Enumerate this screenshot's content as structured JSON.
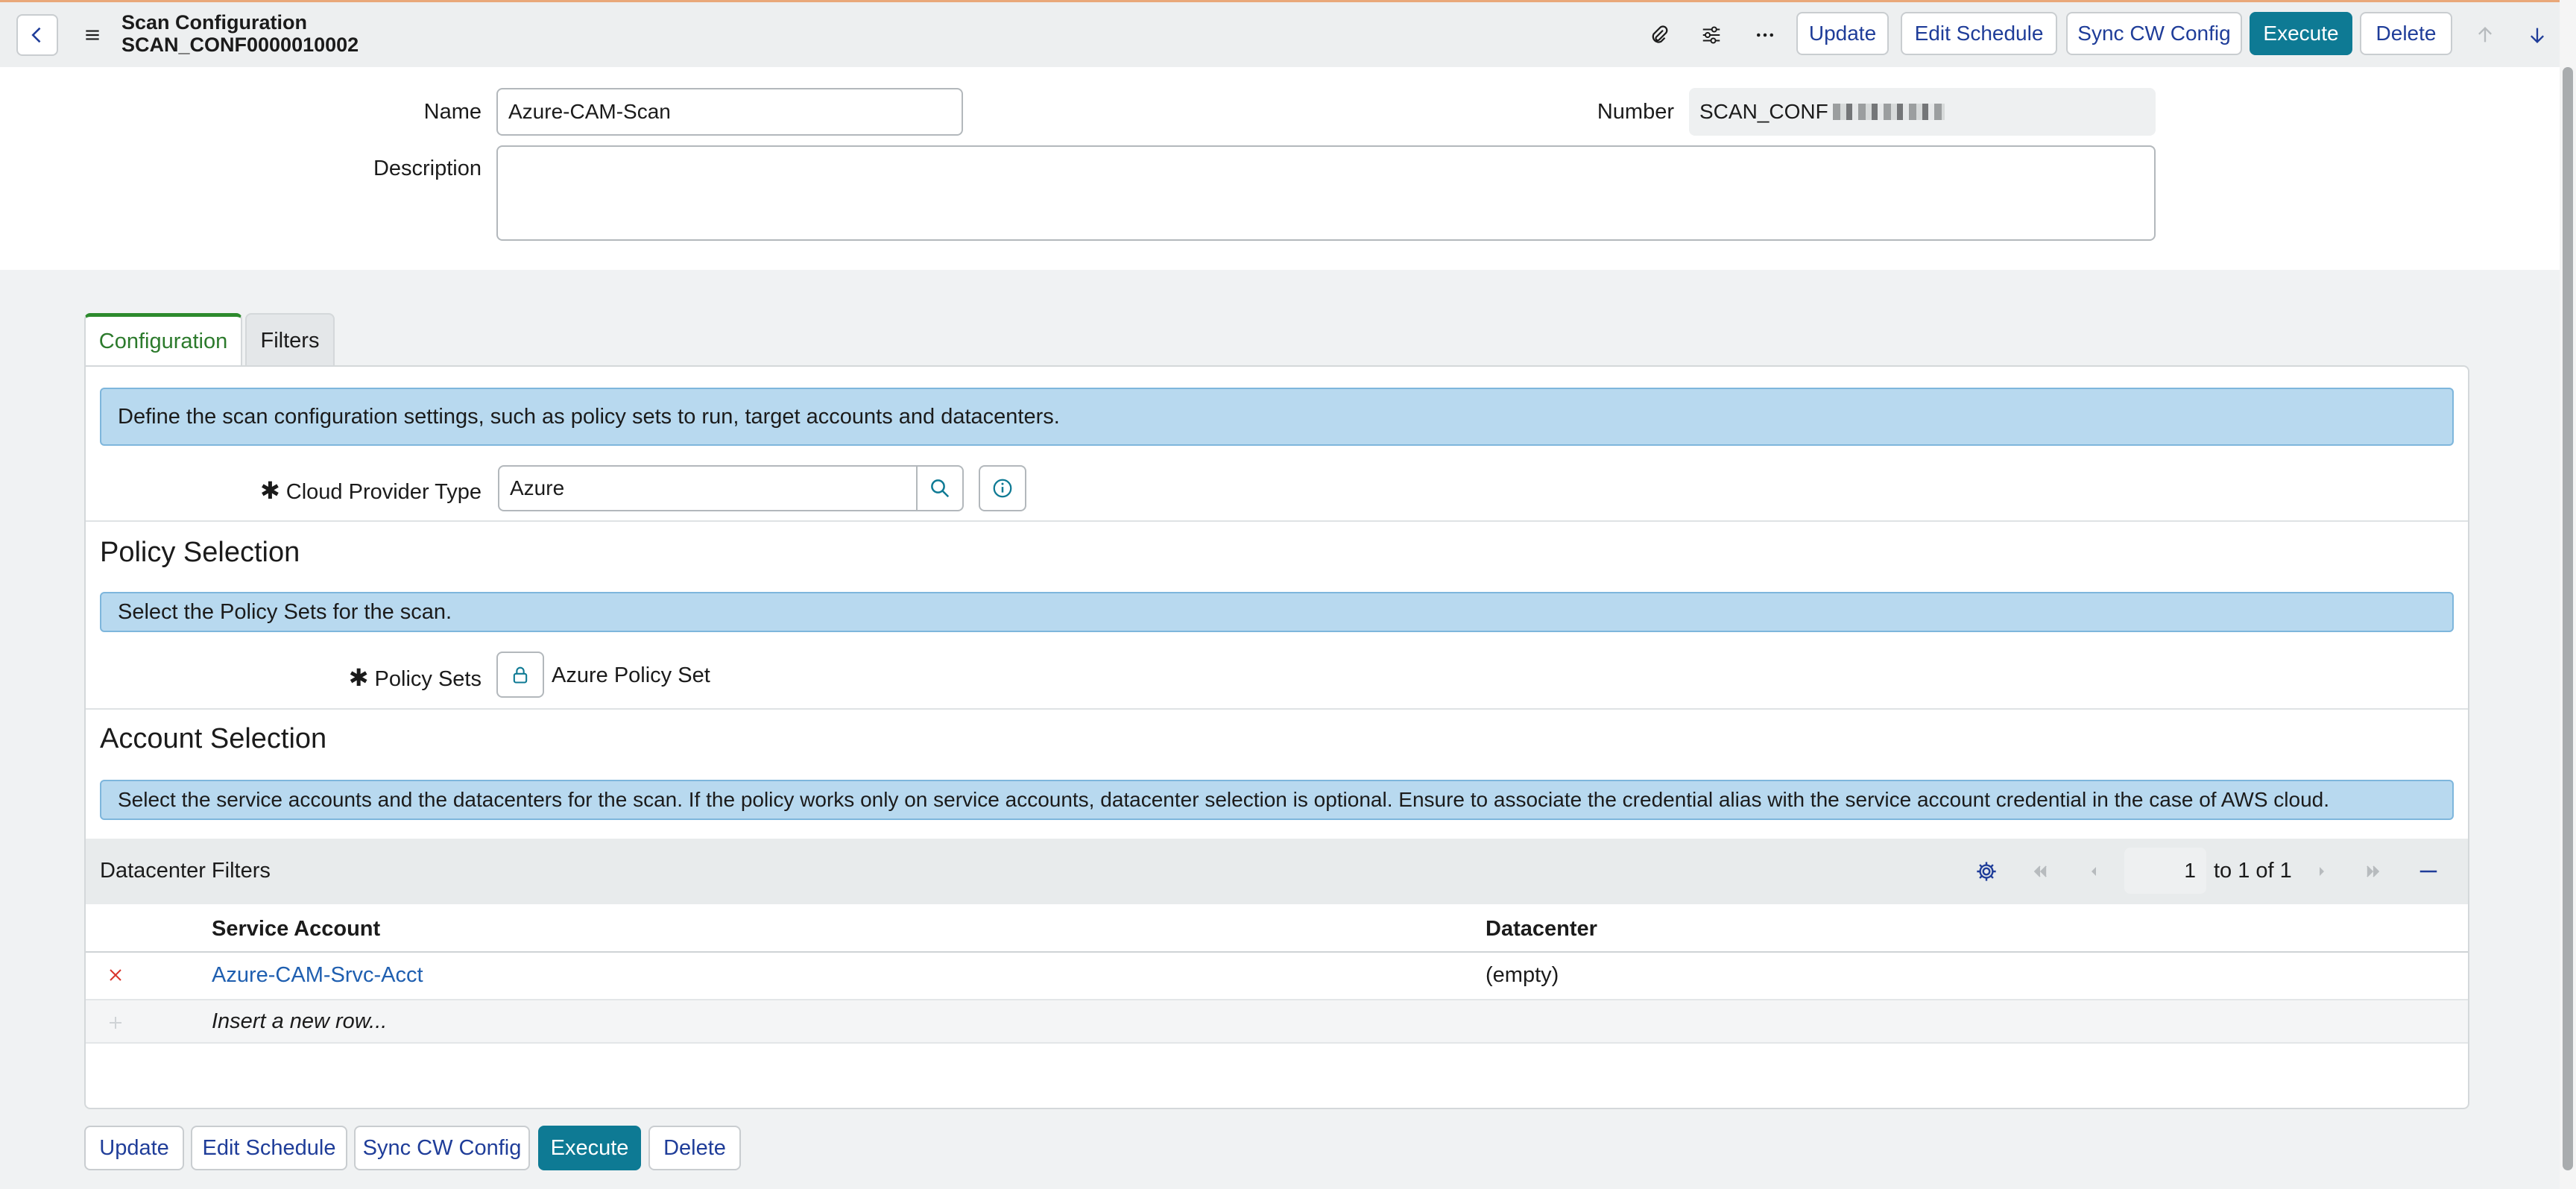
{
  "header": {
    "form_type": "Scan Configuration",
    "record_number": "SCAN_CONF0000010002",
    "buttons": {
      "update": "Update",
      "edit_schedule": "Edit Schedule",
      "sync_cw_config": "Sync CW Config",
      "execute": "Execute",
      "delete": "Delete"
    },
    "icons": [
      "back-icon",
      "menu-icon",
      "paperclip-icon",
      "settings-sliders-icon",
      "more-icon",
      "arrow-up-icon",
      "arrow-down-icon"
    ]
  },
  "form": {
    "name_label": "Name",
    "name_value": "Azure-CAM-Scan",
    "number_label": "Number",
    "number_value": "SCAN_CONF",
    "description_label": "Description",
    "description_value": ""
  },
  "tabs": [
    {
      "label": "Configuration",
      "active": true
    },
    {
      "label": "Filters",
      "active": false
    }
  ],
  "configuration": {
    "intro": "Define the scan configuration settings, such as policy sets to run, target accounts and datacenters.",
    "cloud_provider_label": "Cloud Provider Type",
    "cloud_provider_value": "Azure",
    "policy_section_title": "Policy Selection",
    "policy_info": "Select the Policy Sets for the scan.",
    "policy_sets_label": "Policy Sets",
    "policy_sets_value": "Azure Policy Set",
    "account_section_title": "Account Selection",
    "account_info": "Select the service accounts and the datacenters for the scan. If the policy works only on service accounts, datacenter selection is optional. Ensure to associate the credential alias with the service account credential in the case of AWS cloud."
  },
  "datacenter_filters": {
    "title": "Datacenter Filters",
    "page_value": "1",
    "page_range": "to 1 of 1",
    "columns": [
      "Service Account",
      "Datacenter"
    ],
    "rows": [
      {
        "service_account": "Azure-CAM-Srvc-Acct",
        "datacenter": "(empty)"
      }
    ],
    "insert_row": "Insert a new row..."
  },
  "footer_buttons": {
    "update": "Update",
    "edit_schedule": "Edit Schedule",
    "sync_cw_config": "Sync CW Config",
    "execute": "Execute",
    "delete": "Delete"
  },
  "colors": {
    "primary": "#0e7a94",
    "active_tab": "#2c8a2c",
    "info_bg": "#b8d9ef",
    "link": "#1f5fb0",
    "delete_x": "#d9342b"
  }
}
